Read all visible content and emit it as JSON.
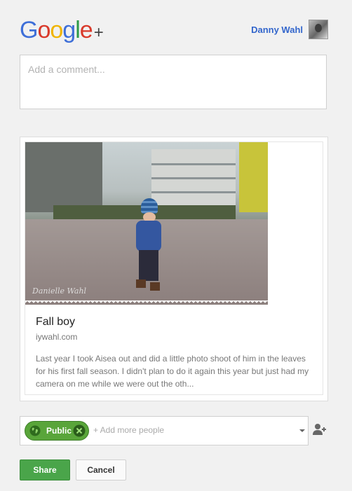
{
  "header": {
    "logo_letters": [
      {
        "ch": "G",
        "color": "#3e6fd8"
      },
      {
        "ch": "o",
        "color": "#d93a2b"
      },
      {
        "ch": "o",
        "color": "#f0b400"
      },
      {
        "ch": "g",
        "color": "#3e6fd8"
      },
      {
        "ch": "l",
        "color": "#2c9a47"
      },
      {
        "ch": "e",
        "color": "#d93a2b"
      }
    ],
    "logo_suffix": "+",
    "user_name": "Danny Wahl"
  },
  "comment": {
    "placeholder": "Add a comment..."
  },
  "attachment": {
    "photo_watermark": "Danielle Wahl",
    "title": "Fall boy",
    "domain": "iywahl.com",
    "description": "Last year I took Aisea out and did a little photo shoot of him in the leaves for his first fall season. I didn't plan to do it again this year but just had my camera on me while we were out the oth..."
  },
  "sharing": {
    "chip_label": "Public",
    "add_placeholder": "+ Add more people"
  },
  "actions": {
    "share_label": "Share",
    "cancel_label": "Cancel"
  },
  "colors": {
    "accent_green": "#4aa54a",
    "link_blue": "#3366cc"
  }
}
